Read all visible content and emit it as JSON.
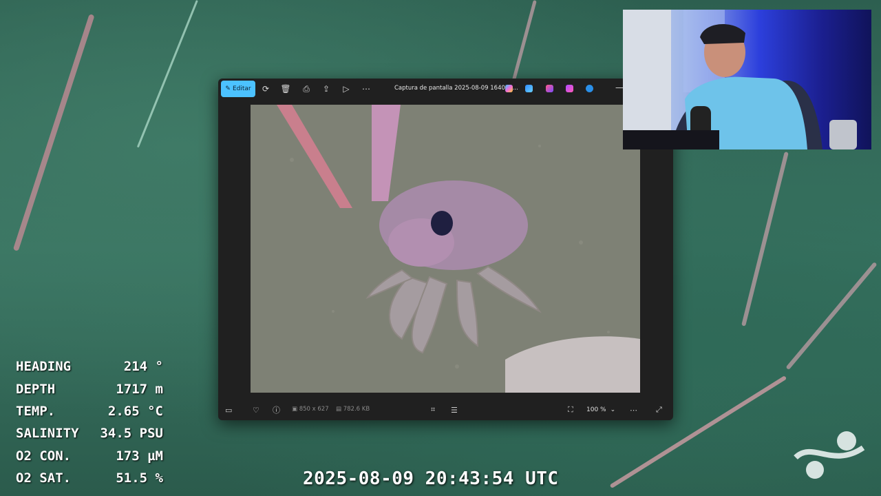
{
  "telemetry": {
    "rows": [
      {
        "label": "HEADING",
        "value": "214 °"
      },
      {
        "label": "DEPTH",
        "value": "1717 m"
      },
      {
        "label": "TEMP.",
        "value": "2.65 °C"
      },
      {
        "label": "SALINITY",
        "value": "34.5 PSU"
      },
      {
        "label": "O2 CON.",
        "value": "173 µM"
      },
      {
        "label": "O2 SAT.",
        "value": "51.5 %"
      }
    ],
    "timestamp": "2025-08-09 20:43:54 UTC"
  },
  "photos_window": {
    "toolbar": {
      "edit_label": "Editar",
      "icons": [
        "rotate-icon",
        "delete-icon",
        "print-icon",
        "share-icon",
        "slideshow-icon",
        "more-icon"
      ],
      "title": "Captura de pantalla 2025-08-09 164055...",
      "app_icons": [
        "copilot-icon",
        "designer-icon",
        "clipchamp-icon",
        "create-icon",
        "onedrive-icon"
      ]
    },
    "bottombar": {
      "dimensions": "850 x 627",
      "file_size": "782.6 KB",
      "zoom": "100 %"
    }
  },
  "colors": {
    "accent": "#4cc2ff",
    "window_bg": "#202020",
    "ocean": "#2d5f50"
  }
}
